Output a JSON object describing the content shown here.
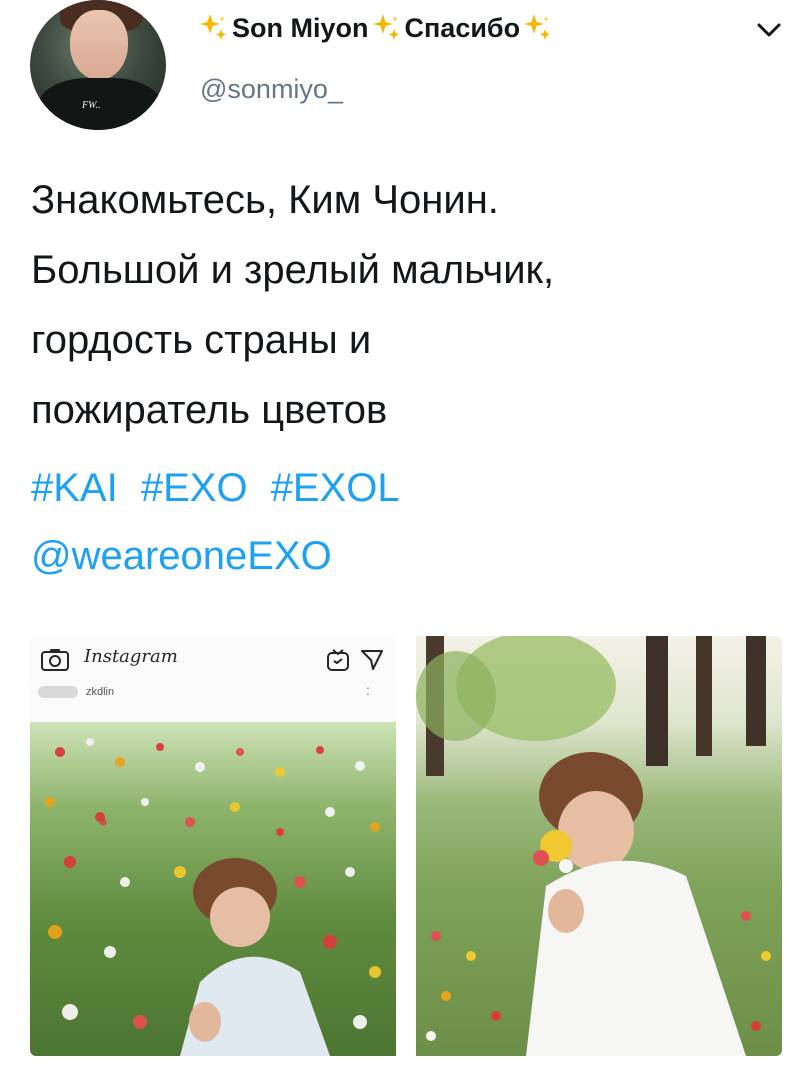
{
  "user": {
    "name_part1": "Son Miyon",
    "name_part2": "Спасибо",
    "handle": "@sonmiyo_",
    "avatar_print": "FW.."
  },
  "tweet": {
    "lines": [
      "Знакомьтесь, Ким Чонин.",
      "Большой и зрелый мальчик,",
      "гордость страны и",
      "пожиратель цветов"
    ],
    "hashtags": [
      "#KAI",
      "#EXO",
      "#EXOL"
    ],
    "mention": "@weareoneEXO"
  },
  "media": {
    "left": {
      "app_title": "Instagram",
      "post_user": "zkdlin",
      "more": ":"
    }
  },
  "colors": {
    "link": "#1da1f2",
    "text": "#14171a",
    "handle": "#657786",
    "sparkle": "#f5b800"
  },
  "icons": [
    "sparkle-icon",
    "chevron-down-icon",
    "camera-icon",
    "igtv-icon",
    "send-icon"
  ]
}
